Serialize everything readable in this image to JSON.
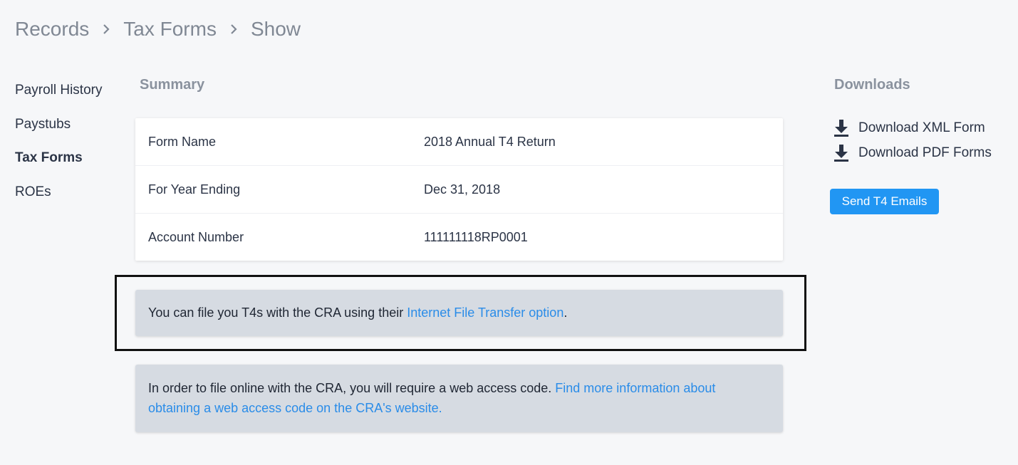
{
  "breadcrumb": {
    "items": [
      "Records",
      "Tax Forms",
      "Show"
    ]
  },
  "sidebar": {
    "items": [
      {
        "label": "Payroll History",
        "active": false
      },
      {
        "label": "Paystubs",
        "active": false
      },
      {
        "label": "Tax Forms",
        "active": true
      },
      {
        "label": "ROEs",
        "active": false
      }
    ]
  },
  "summary": {
    "title": "Summary",
    "rows": [
      {
        "label": "Form Name",
        "value": "2018 Annual T4 Return"
      },
      {
        "label": "For Year Ending",
        "value": "Dec 31, 2018"
      },
      {
        "label": "Account Number",
        "value": "111111118RP0001"
      }
    ]
  },
  "notices": {
    "ift": {
      "text": "You can file you T4s with the CRA using their ",
      "link": "Internet File Transfer option",
      "suffix": "."
    },
    "wac": {
      "text": "In order to file online with the CRA, you will require a web access code. ",
      "link": "Find more information about obtaining a web access code on the CRA's website."
    }
  },
  "downloads": {
    "title": "Downloads",
    "links": [
      {
        "label": "Download XML Form",
        "icon": "download-icon"
      },
      {
        "label": "Download PDF Forms",
        "icon": "download-icon"
      }
    ],
    "send_button": "Send T4 Emails"
  },
  "colors": {
    "accent": "#2196f3",
    "link": "#2a8ce8",
    "notice_bg": "#d6dbe2",
    "page_bg": "#f6f7f9"
  }
}
